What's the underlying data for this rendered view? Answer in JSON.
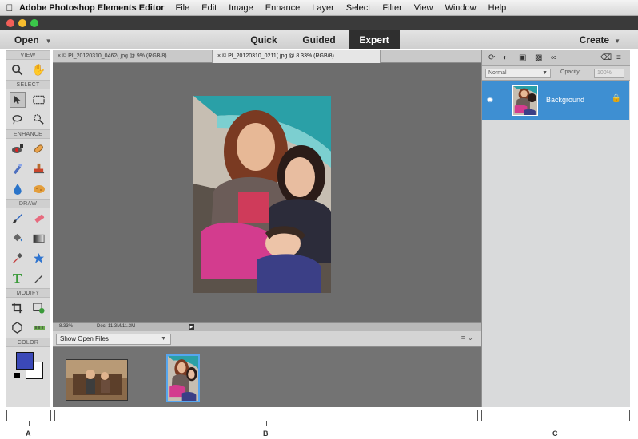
{
  "menubar": {
    "apple_icon": "apple-icon",
    "app_name": "Adobe Photoshop Elements Editor",
    "items": [
      "File",
      "Edit",
      "Image",
      "Enhance",
      "Layer",
      "Select",
      "Filter",
      "View",
      "Window",
      "Help"
    ]
  },
  "window": {
    "traffic_lights": [
      "#f25f58",
      "#f8bd2e",
      "#3bc84a"
    ]
  },
  "modebar": {
    "open_label": "Open",
    "tabs": [
      {
        "label": "Quick",
        "active": false
      },
      {
        "label": "Guided",
        "active": false
      },
      {
        "label": "Expert",
        "active": true
      }
    ],
    "create_label": "Create"
  },
  "toolbox": {
    "sections": [
      {
        "title": "VIEW",
        "tools": [
          "zoom-icon",
          "hand-icon"
        ]
      },
      {
        "title": "SELECT",
        "tools": [
          "move-icon",
          "marquee-icon",
          "lasso-icon",
          "quick-selection-icon"
        ]
      },
      {
        "title": "ENHANCE",
        "tools": [
          "red-eye-icon",
          "healing-brush-icon",
          "smart-brush-icon",
          "clone-stamp-icon",
          "blur-icon",
          "sponge-icon"
        ]
      },
      {
        "title": "DRAW",
        "tools": [
          "brush-icon",
          "eraser-icon",
          "paint-bucket-icon",
          "gradient-icon",
          "eyedropper-icon",
          "shape-icon",
          "type-icon",
          "pencil-icon"
        ]
      },
      {
        "title": "MODIFY",
        "tools": [
          "crop-icon",
          "recompose-icon",
          "content-aware-move-icon",
          "straighten-icon"
        ]
      },
      {
        "title": "COLOR",
        "tools": []
      }
    ],
    "foreground_color": "#3b49b8",
    "background_color": "#ffffff"
  },
  "document": {
    "tabs": [
      {
        "label": "× © PI_20120310_0462(.jpg @ 9% (RGB/8)",
        "active": false
      },
      {
        "label": "× © PI_20120310_0211(.jpg @ 8.33% (RGB/8)",
        "active": true
      }
    ],
    "status": {
      "zoom": "8.33%",
      "doc": "Doc: 11.3M/11.3M"
    }
  },
  "photo_bin": {
    "show_label": "Show Open Files",
    "thumbnails": [
      "family-photo-1",
      "family-photo-2"
    ]
  },
  "layers_panel": {
    "blend_mode": "Normal",
    "opacity_label": "Opacity:",
    "opacity_value": "100%",
    "layers": [
      {
        "name": "Background",
        "selected": true
      }
    ]
  },
  "callouts": {
    "labels": [
      "A",
      "B",
      "C"
    ]
  }
}
